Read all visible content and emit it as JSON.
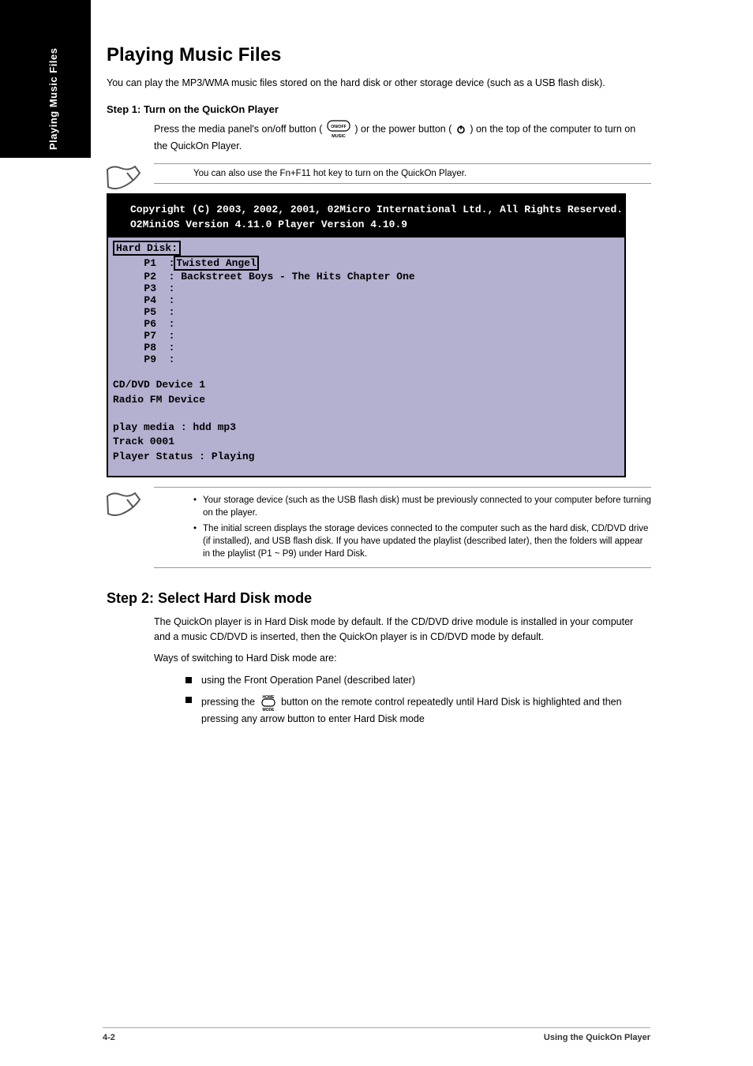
{
  "tab": {
    "label": "Playing Music Files"
  },
  "heading": "Playing Music Files",
  "intro": "You can play the MP3/WMA music files stored on the hard disk or other storage device (such as a USB flash disk).",
  "step1": {
    "title": "Step 1: Turn on the QuickOn Player"
  },
  "step1_text": {
    "pre": "Press the media panel's on/off button (",
    "mid": ") or the power button ( ",
    "post": " ) on the top of the computer to turn on the QuickOn Player."
  },
  "note1": "You can also use the Fn+F11 hot key to turn on the QuickOn Player.",
  "screen": {
    "copyright": "Copyright (C) 2003, 2002, 2001, 02Micro International Ltd., All Rights Reserved.",
    "osver": "O2MiniOS Version 4.11.0 Player Version 4.10.9",
    "hd_label": "Hard Disk:",
    "tracks": [
      {
        "slot": "P1",
        "title": "Twisted Angel"
      },
      {
        "slot": "P2",
        "title": "Backstreet Boys - The Hits Chapter One"
      },
      {
        "slot": "P3",
        "title": ""
      },
      {
        "slot": "P4",
        "title": ""
      },
      {
        "slot": "P5",
        "title": ""
      },
      {
        "slot": "P6",
        "title": ""
      },
      {
        "slot": "P7",
        "title": ""
      },
      {
        "slot": "P8",
        "title": ""
      },
      {
        "slot": "P9",
        "title": ""
      }
    ],
    "dev1": "CD/DVD Device 1",
    "dev2": "Radio FM Device",
    "pm": "play media : hdd mp3",
    "track": "Track 0001",
    "status": "Player Status : Playing"
  },
  "note2": {
    "b1": "Your storage device (such as the USB flash disk) must be previously connected to your computer before turning on the player.",
    "b2": "The initial screen displays the storage devices connected to the computer such as the hard disk, CD/DVD drive (if installed), and USB flash disk. If you have updated the playlist (described later), then the folders will appear in the playlist (P1 ~ P9) under Hard Disk."
  },
  "step2": {
    "title": "Step 2: Select Hard Disk mode",
    "p1": "The QuickOn player is in Hard Disk mode by default. If the CD/DVD drive module is installed in your computer and a music CD/DVD is inserted, then the QuickOn player is in CD/DVD mode by default.",
    "p2": "Ways of switching to Hard Disk mode are:",
    "bul1": "using the Front Operation Panel (described later)",
    "bul2_pre": "pressing the ",
    "bul2_post": " button on the remote control repeatedly until Hard Disk is highlighted and then pressing any arrow button to enter Hard Disk mode"
  },
  "footer": {
    "page": "4-2",
    "title": "Using the QuickOn Player"
  }
}
